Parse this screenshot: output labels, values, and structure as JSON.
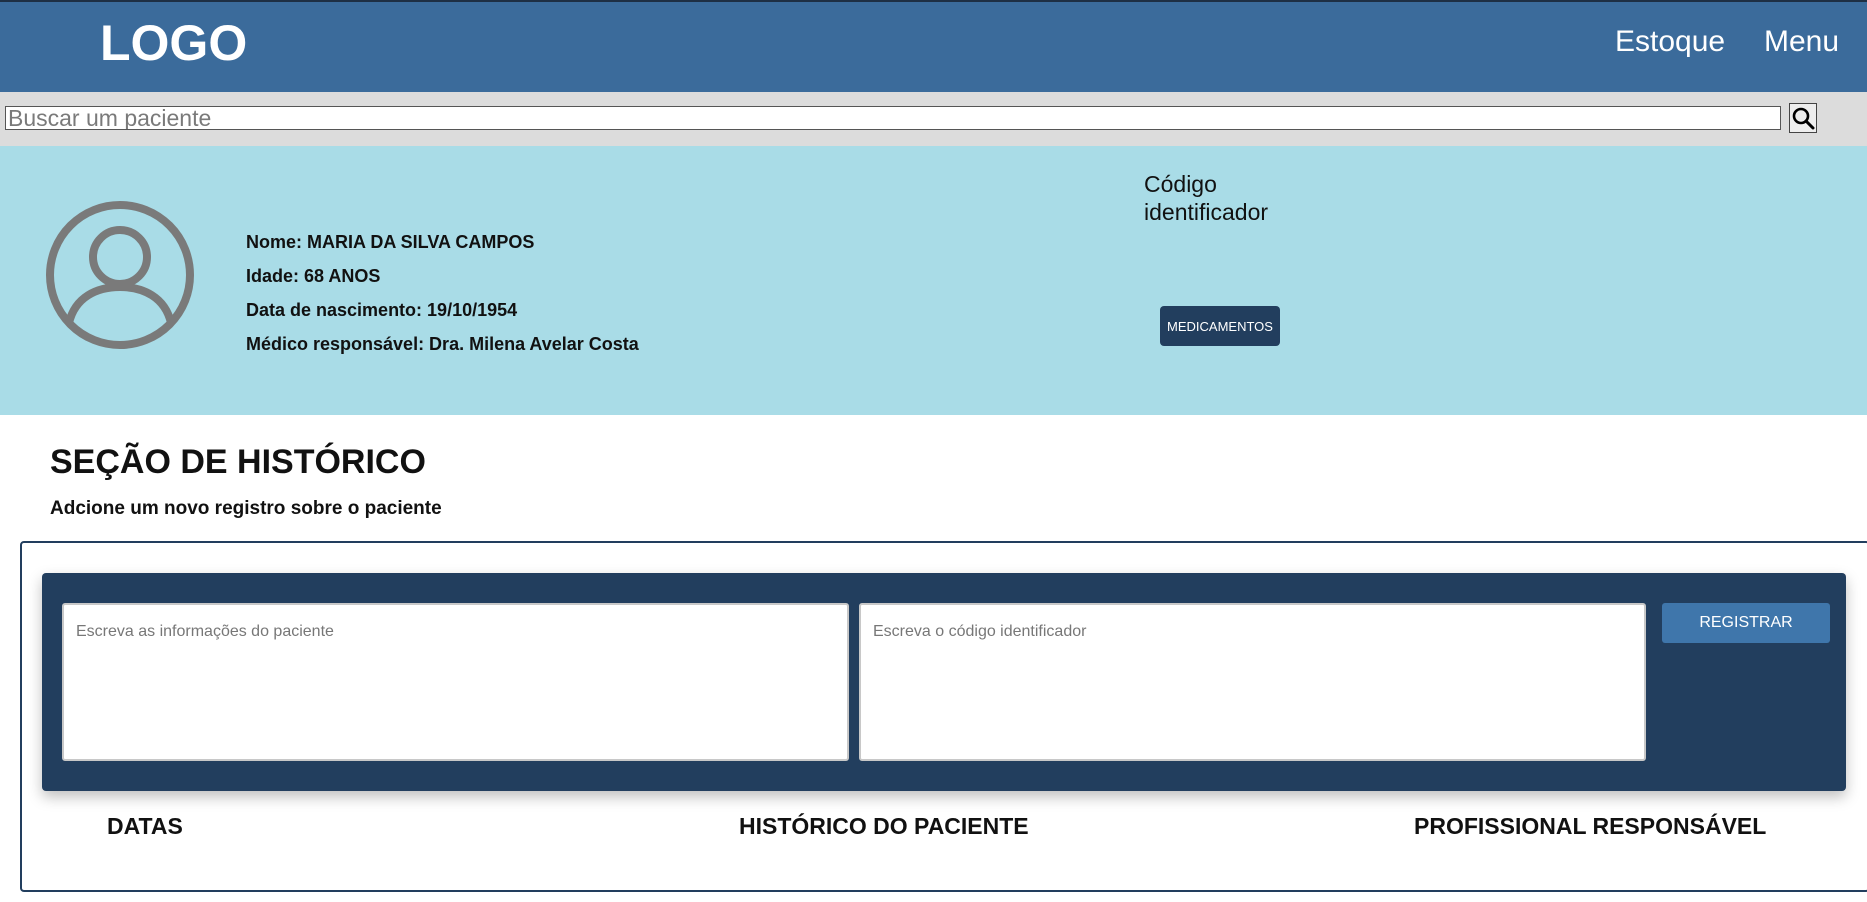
{
  "header": {
    "logo": "LOGO",
    "nav": [
      "Estoque",
      "Menu"
    ],
    "background": "#3b6b9b"
  },
  "search": {
    "placeholder": "Buscar um paciente",
    "value": "",
    "icon": "search-icon"
  },
  "patient": {
    "avatar_icon": "user-circle-icon",
    "lines": [
      "Nome: MARIA DA SILVA CAMPOS",
      "Idade: 68 ANOS",
      "Data de nascimento: 19/10/1954",
      "Médico responsável: Dra. Milena Avelar Costa"
    ],
    "code_label": "Código identificador",
    "medications_button": "MEDICAMENTOS",
    "background": "#a9dce7"
  },
  "history": {
    "title": "SEÇÃO DE HISTÓRICO",
    "subtitle": "Adcione um novo registro sobre o paciente",
    "info_placeholder": "Escreva as informações do paciente",
    "code_placeholder": "Escreva o código identificador",
    "register_button": "REGISTRAR",
    "columns": [
      "DATAS",
      "HISTÓRICO DO PACIENTE",
      "PROFISSIONAL RESPONSÁVEL"
    ],
    "panel_color": "#223e5e",
    "button_color": "#3f76ab"
  }
}
